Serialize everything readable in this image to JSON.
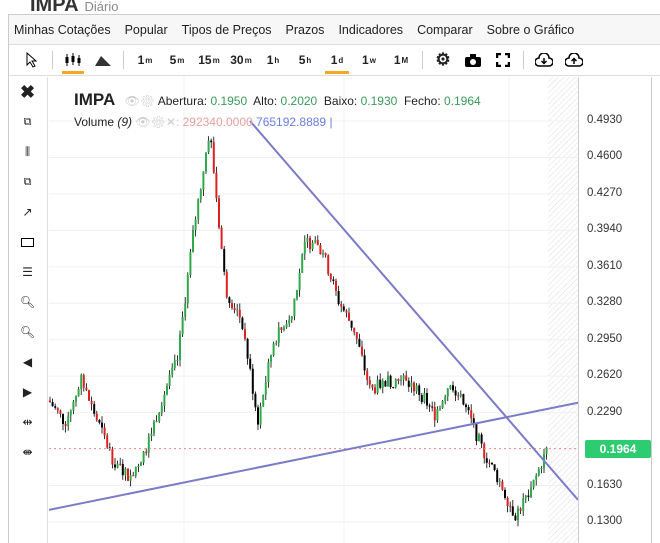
{
  "header": {
    "symbol": "IMPA",
    "period": "Diário"
  },
  "menu": [
    "Minhas Cotações",
    "Popular",
    "Tipos de Preços",
    "Prazos",
    "Indicadores",
    "Comparar",
    "Sobre o Gráfico"
  ],
  "timeframes": [
    {
      "n": "1",
      "s": "m"
    },
    {
      "n": "5",
      "s": "m"
    },
    {
      "n": "15",
      "s": "m"
    },
    {
      "n": "30",
      "s": "m"
    },
    {
      "n": "1",
      "s": "h"
    },
    {
      "n": "5",
      "s": "h"
    },
    {
      "n": "1",
      "s": "d",
      "active": true
    },
    {
      "n": "1",
      "s": "w"
    },
    {
      "n": "1",
      "s": "M"
    }
  ],
  "legend": {
    "symbol": "IMPA",
    "open_label": "Abertura:",
    "open": "0.1950",
    "high_label": "Alto:",
    "high": "0.2020",
    "low_label": "Baixo:",
    "low": "0.1930",
    "close_label": "Fecho:",
    "close": "0.1964"
  },
  "volume": {
    "label": "Volume",
    "param": "(9)",
    "value1": "292340.0000",
    "value2": "765192.8889"
  },
  "colors": {
    "up": "#2eaa4a",
    "down": "#e02020",
    "trend": "#7b7bc8",
    "price_tag": "#2ecc71",
    "accent": "#f5a623"
  },
  "chart_data": {
    "type": "candlestick",
    "y_ticks": [
      "0.4930",
      "0.4600",
      "0.4270",
      "0.3940",
      "0.3610",
      "0.3280",
      "0.2950",
      "0.2620",
      "0.2290",
      "0.1630",
      "0.1300"
    ],
    "ylim": [
      0.13,
      0.493
    ],
    "last_price": "0.1964",
    "close_path": [
      0.24,
      0.22,
      0.258,
      0.222,
      0.186,
      0.17,
      0.195,
      0.24,
      0.277,
      0.394,
      0.485,
      0.34,
      0.313,
      0.222,
      0.295,
      0.313,
      0.385,
      0.376,
      0.331,
      0.304,
      0.249,
      0.258,
      0.258,
      0.249,
      0.227,
      0.258,
      0.231,
      0.195,
      0.168,
      0.136,
      0.159,
      0.196
    ],
    "trendlines": [
      {
        "from": [
          0.38,
          0.493
        ],
        "to": [
          1.0,
          0.15
        ]
      },
      {
        "from": [
          0.0,
          0.141
        ],
        "to": [
          1.0,
          0.238
        ]
      }
    ]
  }
}
